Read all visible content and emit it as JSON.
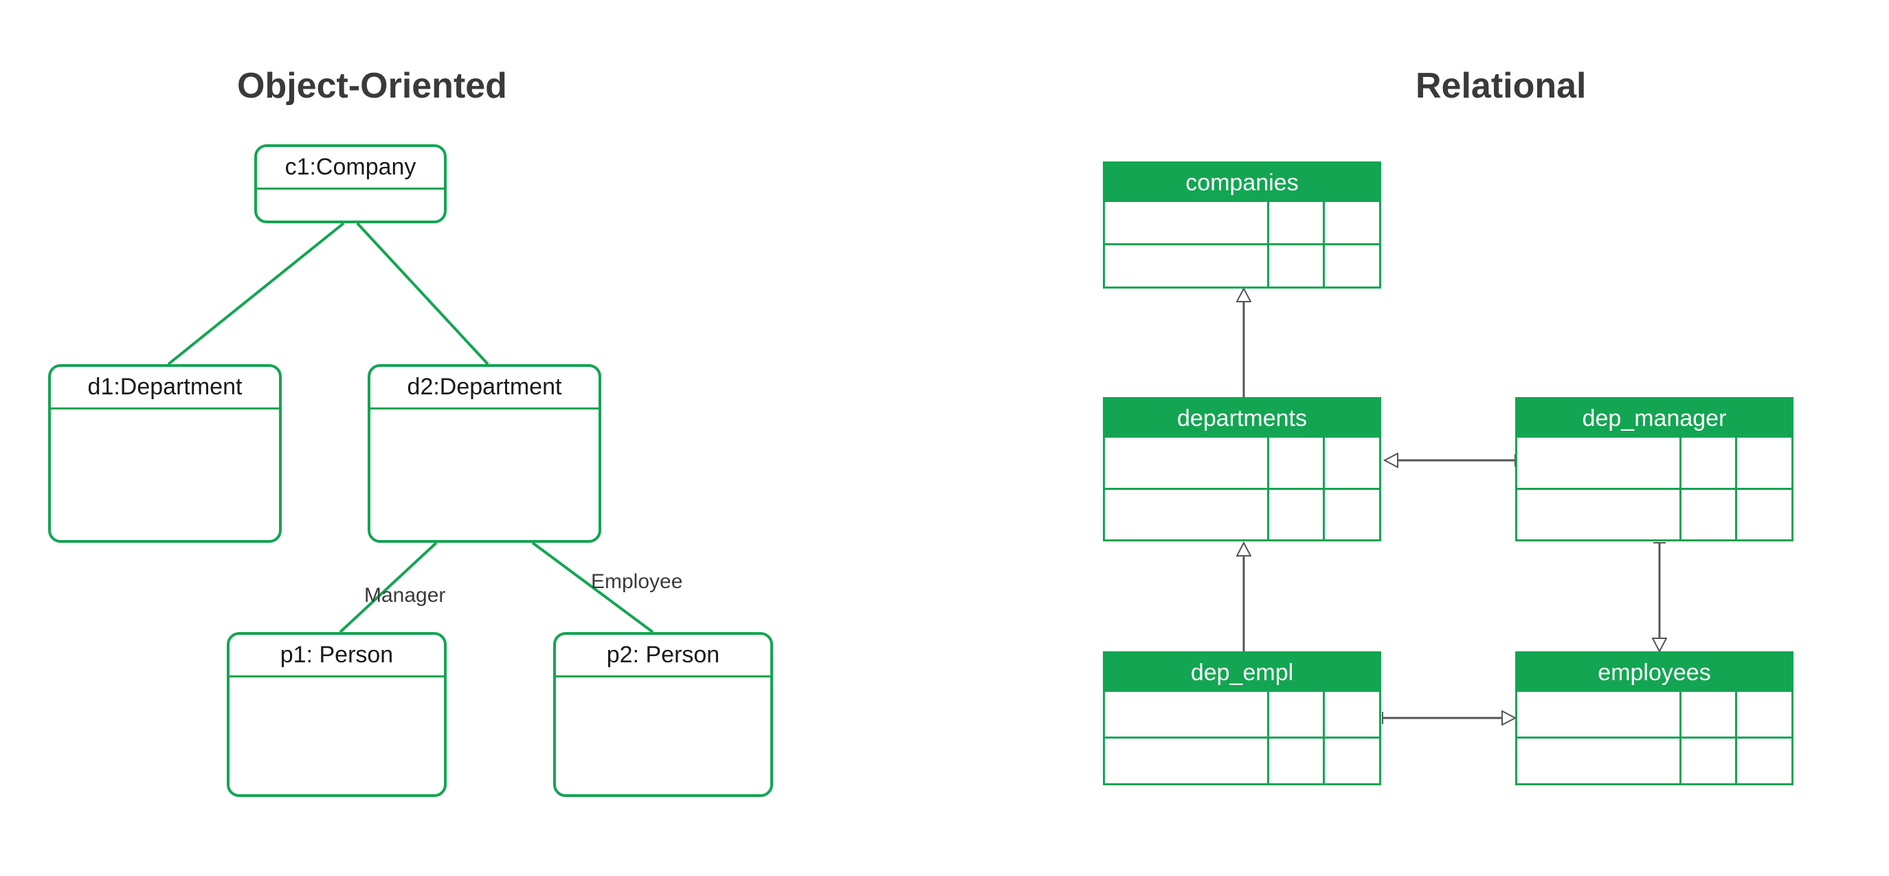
{
  "left": {
    "title": "Object-Oriented",
    "nodes": {
      "c1": "c1:Company",
      "d1": "d1:Department",
      "d2": "d2:Department",
      "p1": "p1: Person",
      "p2": "p2: Person"
    },
    "edgeLabels": {
      "manager": "Manager",
      "employee": "Employee"
    }
  },
  "right": {
    "title": "Relational",
    "tables": {
      "companies": "companies",
      "departments": "departments",
      "dep_manager": "dep_manager",
      "dep_empl": "dep_empl",
      "employees": "employees"
    }
  }
}
